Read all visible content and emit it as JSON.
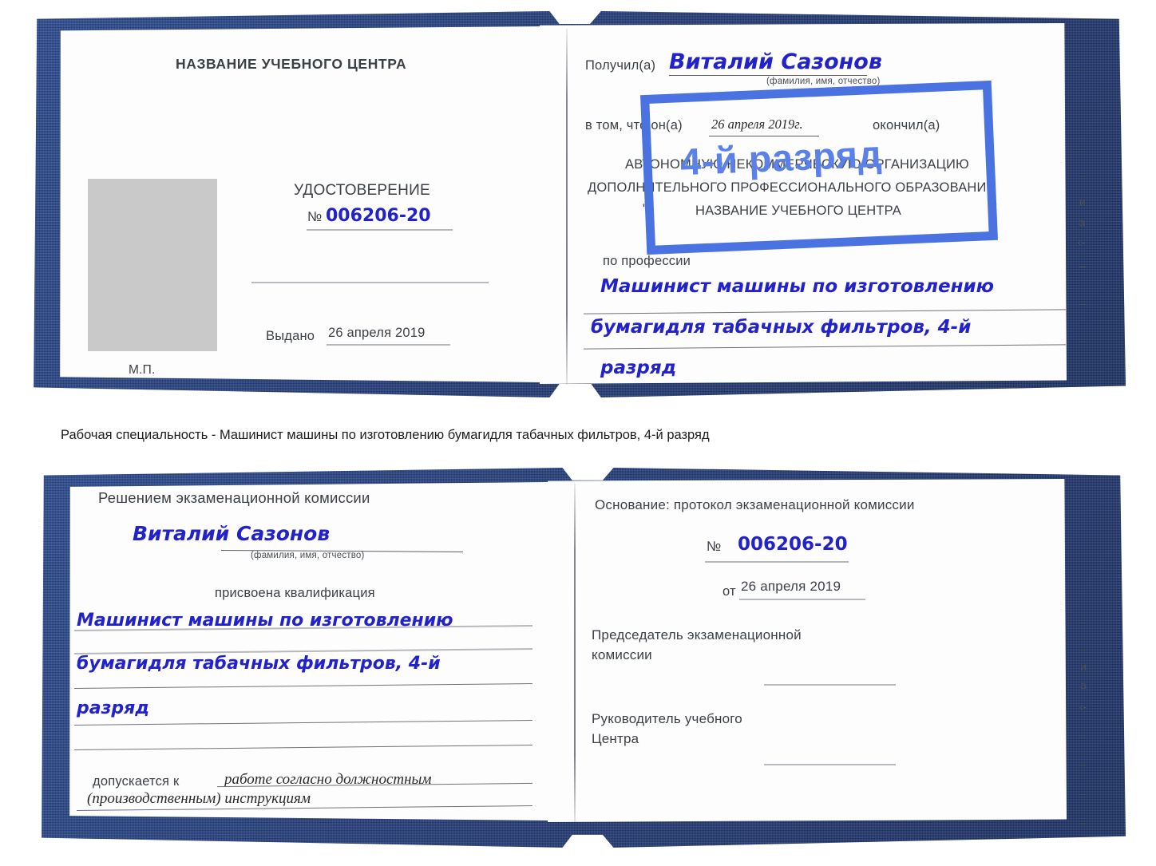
{
  "caption": "Рабочая специальность - Машинист машины по изготовлению бумагидля табачных фильтров, 4-й разряд",
  "colors": {
    "cover_blue": "#27407d",
    "handwriting_blue": "#2222cc",
    "stamp_blue": "#4a72e0",
    "paper": "#fdfdfd",
    "rule_gray": "#b6b9bd",
    "photo_gray": "#c9c9c9"
  },
  "certificate_top": {
    "left_page": {
      "heading": "НАЗВАНИЕ УЧЕБНОГО ЦЕНТРА",
      "doc_type": "УДОСТОВЕРЕНИЕ",
      "number_label": "№",
      "number_value": "006206-20",
      "issued_label": "Выдано",
      "issued_value": "26 апреля 2019",
      "seal_label": "М.П."
    },
    "right_page": {
      "received_label": "Получил(а)",
      "received_value": "Виталий Сазонов",
      "name_hint": "(фамилия, имя, отчество)",
      "fact_label": "в том, что он(а)",
      "fact_date": "26 апреля 2019г.",
      "finished_label": "окончил(а)",
      "org_line1": "АВТОНОМНУЮ НЕКОММЕРЧЕСКУЮ ОРГАНИЗАЦИЮ",
      "org_line2": "ДОПОЛНИТЕЛЬНОГО ПРОФЕССИОНАЛЬНОГО ОБРАЗОВАНИЯ",
      "org_quote_open": "\"",
      "org_name": "НАЗВАНИЕ УЧЕБНОГО ЦЕНТРА",
      "org_quote_close": "\"",
      "profession_label": "по профессии",
      "profession_line1": "Машинист машины по изготовлению",
      "profession_line2": "бумагидля табачных фильтров, 4-й",
      "profession_line3": "разряд",
      "stamp_text": "4-й разряд"
    },
    "edge_marks": [
      "–",
      "–",
      "–",
      "и",
      "а",
      "‹-",
      "–",
      "–",
      "–"
    ]
  },
  "certificate_bottom": {
    "left_page": {
      "heading": "Решением экзаменационной комиссии",
      "name_value": "Виталий Сазонов",
      "name_hint": "(фамилия, имя, отчество)",
      "qualification_label": "присвоена квалификация",
      "qualification_line1": "Машинист машины по изготовлению",
      "qualification_line2": "бумагидля табачных фильтров, 4-й",
      "qualification_line3": "разряд",
      "admitted_label": "допускается к",
      "admitted_line1": "работе согласно должностным",
      "admitted_line2": "(производственным) инструкциям"
    },
    "right_page": {
      "basis_label": "Основание: протокол экзаменационной комиссии",
      "number_label": "№",
      "number_value": "006206-20",
      "date_label": "от",
      "date_value": "26 апреля 2019",
      "chairman_line1": "Председатель экзаменационной",
      "chairman_line2": "комиссии",
      "head_line1": "Руководитель учебного",
      "head_line2": "Центра"
    },
    "edge_marks": [
      "–",
      "–",
      "и",
      "а",
      "‹-",
      "–",
      "–",
      "–",
      "–"
    ]
  }
}
